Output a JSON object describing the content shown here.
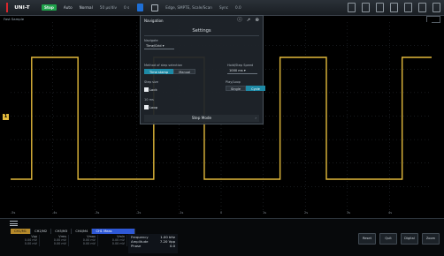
{
  "topbar": {
    "brand": "UNI-T",
    "run_state": "Stop",
    "items": [
      "Auto",
      "Normal",
      "50 μs/div",
      "0 s"
    ],
    "trigger": "Edge, SMPTE, Scale/Scan",
    "trig_src": "Sync",
    "trig_level": "0.0"
  },
  "subbar": {
    "label": "Fast Sample"
  },
  "ch1_marker": "1",
  "time_ticks": [
    "-5s",
    "-4s",
    "-3s",
    "-2s",
    "-1s",
    "0",
    "1s",
    "2s",
    "3s",
    "4s"
  ],
  "dialog": {
    "title": "Navigation",
    "settings_label": "Settings",
    "navigate_label": "Navigate",
    "navigate_value": "Time/Grid",
    "method_label": "Method of step selection",
    "method_options": [
      "Time stamp",
      "Manual"
    ],
    "method_selected": 0,
    "interval_label": "Hold/Step Speed",
    "interval_value": "1000 ms",
    "stepsize_label": "Step size",
    "stepsize_value": "10 ms",
    "playback_label": "Play/Loop",
    "playback_options": [
      "Single",
      "Cycle"
    ],
    "playback_selected": 1,
    "check1": "Lock",
    "check2": "Loop",
    "bottom_button": "Step Mode"
  },
  "bottom": {
    "tabs": [
      "CH1/M1",
      "CH2/M2",
      "CH3/M3",
      "CH4/M4",
      "CH1 Meas"
    ],
    "active_tab": 0,
    "columns": [
      {
        "label": "Vpp",
        "v1": "0.00 mV",
        "v2": "0.00 mV"
      },
      {
        "label": "Vrms",
        "v1": "0.00 mV",
        "v2": "0.00 mV"
      },
      {
        "label": "Vmax",
        "v1": "0.00 mV",
        "v2": "0.00 mV"
      },
      {
        "label": "Vmin",
        "v1": "0.00 mV",
        "v2": "0.00 mV"
      }
    ],
    "meas": [
      {
        "k": "Frequency",
        "v": "1.00 kHz"
      },
      {
        "k": "Amplitude",
        "v": "7.20 Vpp"
      },
      {
        "k": "Phase",
        "v": "0.0"
      }
    ],
    "buttons": [
      "Reset",
      "Quit",
      "Digital",
      "Zoom"
    ]
  },
  "chart_data": {
    "type": "line",
    "series": [
      {
        "color": "#e2b93b",
        "waveform": "square",
        "edges_x": [
          0.05,
          0.16,
          0.34,
          0.46,
          0.64,
          0.75,
          0.93
        ],
        "start_level": "low"
      }
    ],
    "grid": true
  }
}
